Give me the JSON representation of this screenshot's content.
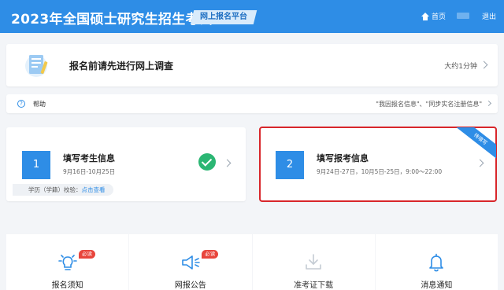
{
  "header": {
    "title": "2023年全国硕士研究生招生考试",
    "platform": "网上报名平台",
    "home_label": "首页",
    "logout_label": "退出"
  },
  "survey": {
    "title": "报名前请先进行网上调查",
    "time": "大约1分钟"
  },
  "help": {
    "label": "帮助",
    "text": "\"我因报名信息\"、\"同步实名注册信息\""
  },
  "steps": [
    {
      "number": "1",
      "title": "填写考生信息",
      "date": "9月16日-10月25日",
      "status": "completed",
      "verify_label": "学历（学籍）校验：",
      "verify_link": "点击查看"
    },
    {
      "number": "2",
      "title": "填写报考信息",
      "date": "9月24日-27日，10月5日-25日，9:00～22:00",
      "ribbon": "待填写"
    }
  ],
  "tiles": [
    {
      "label": "报名须知",
      "icon": "bulb-icon",
      "badge": "必读"
    },
    {
      "label": "网报公告",
      "icon": "megaphone-icon",
      "badge": "必读"
    },
    {
      "label": "准考证下载",
      "icon": "download-icon",
      "badge": ""
    },
    {
      "label": "消息通知",
      "icon": "bell-icon",
      "badge": ""
    }
  ],
  "colors": {
    "primary": "#2e8de6",
    "success": "#2bb673",
    "highlight_border": "#d8262b",
    "badge": "#e8453c"
  }
}
